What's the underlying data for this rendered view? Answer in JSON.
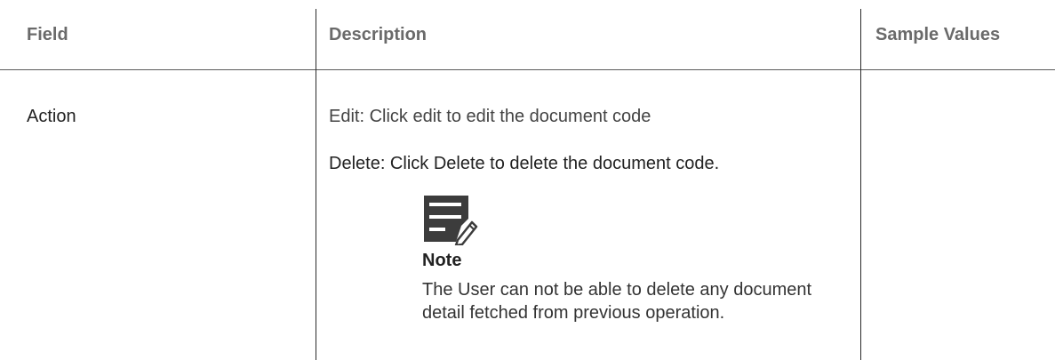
{
  "table": {
    "headers": {
      "field": "Field",
      "description": "Description",
      "sample_values": "Sample Values"
    },
    "rows": [
      {
        "field": "Action",
        "description": {
          "edit": "Edit: Click edit to edit the document code",
          "delete": "Delete: Click Delete to delete the document code.",
          "note": {
            "icon": "note-edit-icon",
            "title": "Note",
            "body": "The User can not be able to delete any document detail fetched from previous operation."
          }
        },
        "sample_values": ""
      }
    ]
  },
  "colors": {
    "header_text": "#6a6a6a",
    "body_text": "#222222",
    "icon": "#3c3c3c"
  }
}
